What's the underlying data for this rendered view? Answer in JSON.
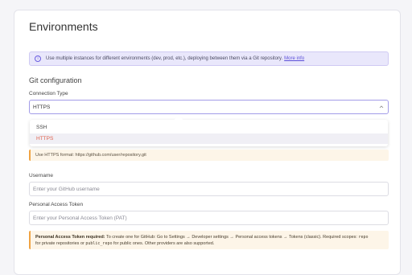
{
  "page": {
    "title": "Environments"
  },
  "info": {
    "text": "Use multiple instances for different environments (dev, prod, etc.), deploying between them via a Git repository.",
    "link": "More info"
  },
  "git": {
    "section_title": "Git configuration",
    "connection_type_label": "Connection Type",
    "connection_type_value": "HTTPS",
    "options": [
      "SSH",
      "HTTPS"
    ],
    "selected_option": "HTTPS",
    "hint": "Use HTTPS format: https://github.com/user/repository.git"
  },
  "username": {
    "label": "Username",
    "placeholder": "Enter your GitHub username"
  },
  "token": {
    "label": "Personal Access Token",
    "placeholder": "Enter your Personal Access Token (PAT)"
  },
  "notice": {
    "bold": "Personal Access Token required:",
    "text1": " To create one for GitHub: Go to Settings → Developer settings → Personal access tokens → Tokens (classic). Required scopes: ",
    "code1": "repo",
    "text2": "for private repositories or ",
    "code2": "public_repo",
    "text3": " for public ones. Other providers are also supported."
  },
  "colors": {
    "accent": "#6b5de0",
    "info_bg": "#e9e7fb",
    "warning": "#f0a343",
    "selected_option_text": "#e0604c"
  }
}
